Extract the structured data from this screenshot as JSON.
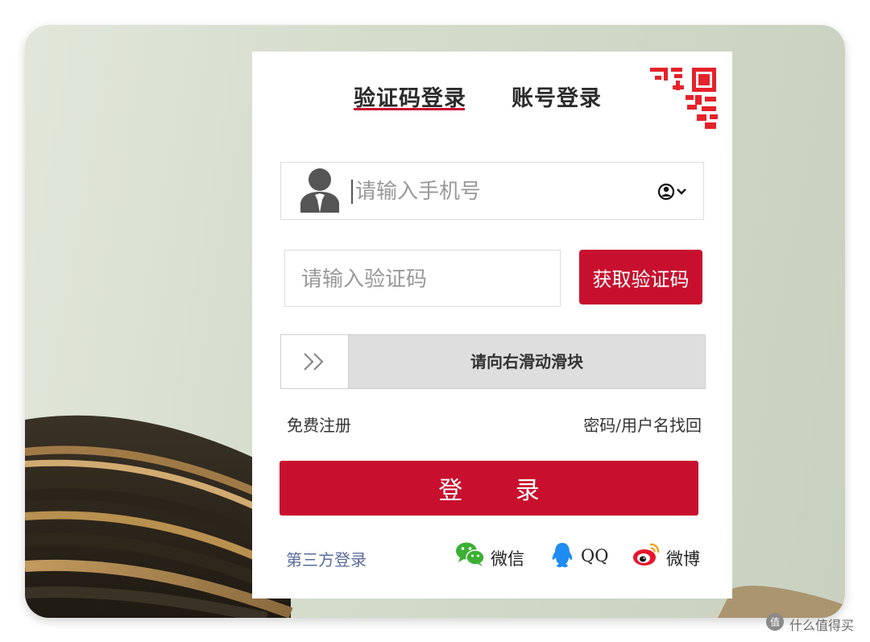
{
  "tabs": [
    {
      "label": "验证码登录",
      "active": true
    },
    {
      "label": "账号登录",
      "active": false
    }
  ],
  "phone_field": {
    "placeholder": "请输入手机号"
  },
  "code_field": {
    "placeholder": "请输入验证码"
  },
  "get_code_button": "获取验证码",
  "slider": {
    "label": "请向右滑动滑块",
    "progress": 0
  },
  "links": {
    "register": "免费注册",
    "recover": "密码/用户名找回"
  },
  "login_button": "登 录",
  "third_party": {
    "label": "第三方登录",
    "options": [
      {
        "name": "微信",
        "icon": "wechat-icon"
      },
      {
        "name": "QQ",
        "icon": "qq-icon"
      },
      {
        "name": "微博",
        "icon": "weibo-icon"
      }
    ]
  },
  "watermark": "值 什么值得买",
  "colors": {
    "accent": "#c8102e",
    "wechat": "#3cb034",
    "qq": "#1e8cf0",
    "weibo": "#e6162d",
    "third_party_label": "#5b6b9a"
  }
}
